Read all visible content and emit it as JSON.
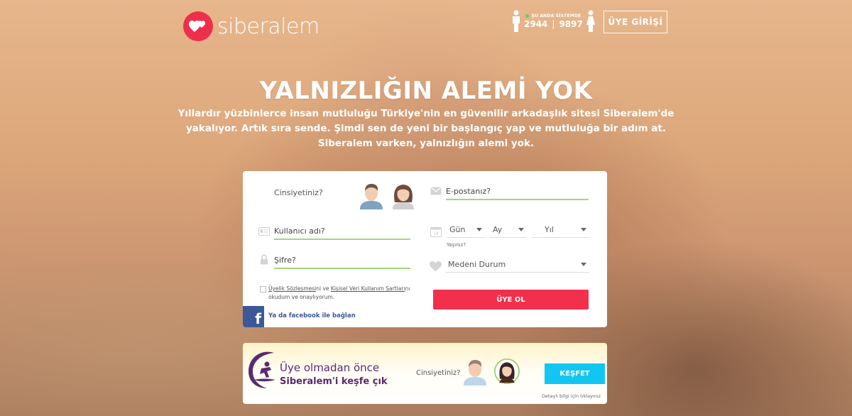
{
  "header": {
    "logo_text": "siberalem",
    "online_label": "ŞU ANDA SİSTEMDE",
    "online_male": "2944",
    "online_separator": "|",
    "online_female": "9897",
    "login_button": "ÜYE GİRİŞİ"
  },
  "hero": {
    "title": "YALNIZLIĞIN ALEMİ YOK",
    "subtitle": "Yıllardır yüzbinlerce insan mutluluğu Türkiye'nin en güvenilir arkadaşlık sitesi Siberalem'de yakalıyor. Artık sıra sende. Şimdi sen de yeni bir başlangıç yap ve mutluluğa bir adım at. Siberalem varken, yalnızlığın alemi yok."
  },
  "form": {
    "gender_label": "Cinsiyetiniz?",
    "email_placeholder": "E-postanız?",
    "username_placeholder": "Kullanıcı adı?",
    "password_placeholder": "Şifre?",
    "day_label": "Gün",
    "month_label": "Ay",
    "year_label": "Yıl",
    "age_label": "Yaşınız?",
    "marital_label": "Medeni Durum",
    "terms_link1": "Üyelik Sözleşmesi",
    "terms_mid": "ni ve ",
    "terms_link2": "Kişisel Veri Kullanım Şartları",
    "terms_end": "nı okudum ve onaylıyorum.",
    "facebook_label": "Ya da facebook ile bağlan",
    "signup_button": "ÜYE OL"
  },
  "banner": {
    "line1": "Üye olmadan önce",
    "line2": "Siberalem'i keşfe çık",
    "gender_label": "Cinsiyetiniz?",
    "explore_button": "KEŞFET",
    "detail_link": "Detaylı bilgi için tıklayınız"
  },
  "colors": {
    "brand_red": "#ee2f4c",
    "accent_green": "#a5d67c",
    "explore_blue": "#13c6f2",
    "facebook_blue": "#3b5998",
    "banner_purple": "#5b2a6e"
  }
}
